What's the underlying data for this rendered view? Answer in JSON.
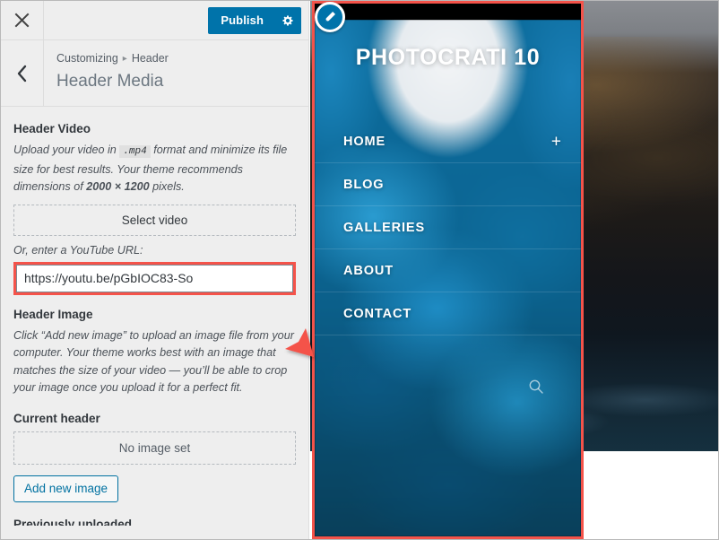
{
  "topbar": {
    "close_icon": "close-icon",
    "publish_label": "Publish",
    "gear_icon": "gear-icon"
  },
  "section_header": {
    "back_icon": "chevron-left-icon",
    "breadcrumb_root": "Customizing",
    "breadcrumb_sep": "▸",
    "breadcrumb_current": "Header",
    "title": "Header Media"
  },
  "header_video": {
    "title": "Header Video",
    "desc_part1": "Upload your video in",
    "desc_code": ".mp4",
    "desc_part2": "format and minimize its file size for best results. Your theme recommends dimensions of",
    "desc_dimensions": "2000 × 1200",
    "desc_part3": "pixels.",
    "select_video_label": "Select video",
    "or_label": "Or, enter a YouTube URL:",
    "url_value": "https://youtu.be/pGbIOC83-So",
    "url_placeholder": "https://"
  },
  "header_image": {
    "title": "Header Image",
    "desc": "Click “Add new image” to upload an image file from your computer. Your theme works best with an image that matches the size of your video — you’ll be able to crop your image once you upload it for a perfect fit.",
    "current_header_label": "Current header",
    "no_image_label": "No image set",
    "add_new_image_label": "Add new image",
    "next_section_label": "Previously uploaded"
  },
  "preview": {
    "site_title": "PHOTOCRATI 10",
    "nav": [
      {
        "label": "HOME",
        "has_plus": true,
        "plus": "+"
      },
      {
        "label": "BLOG",
        "has_plus": false,
        "plus": ""
      },
      {
        "label": "GALLERIES",
        "has_plus": false,
        "plus": ""
      },
      {
        "label": "ABOUT",
        "has_plus": false,
        "plus": ""
      },
      {
        "label": "CONTACT",
        "has_plus": false,
        "plus": ""
      }
    ],
    "search_icon": "search-icon",
    "edit_shortcut_icon": "pencil-icon"
  },
  "annotation": {
    "arrow_icon": "red-arrow-icon",
    "highlight_color": "#f4534a"
  },
  "colors": {
    "accent_blue": "#0073aa",
    "sidebar_bg": "#eeeeee",
    "highlight_red": "#f4534a",
    "link_blue": "#0071a1"
  }
}
